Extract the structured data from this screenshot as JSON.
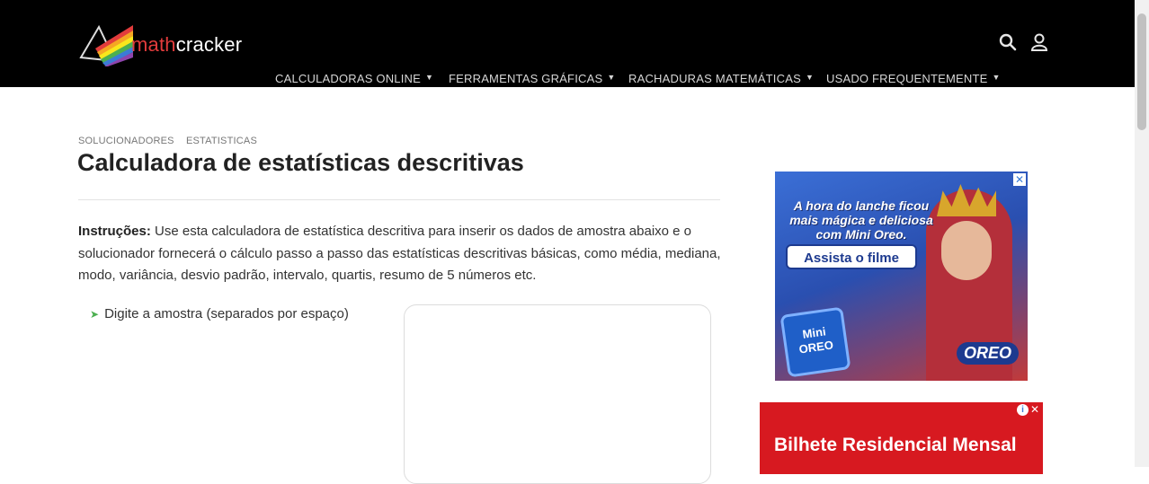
{
  "header": {
    "logo_text_a": "math",
    "logo_text_b": "cracker",
    "icons": [
      "search-icon",
      "user-icon"
    ],
    "nav": [
      {
        "label": "CALCULADORAS ONLINE"
      },
      {
        "label": "FERRAMENTAS GRÁFICAS"
      },
      {
        "label": "RACHADURAS MATEMÁTICAS"
      },
      {
        "label": "USADO FREQUENTEMENTE"
      }
    ]
  },
  "breadcrumb": [
    "SOLUCIONADORES",
    "ESTATISTICAS"
  ],
  "page_title": "Calculadora de estatísticas descritivas",
  "instructions": {
    "label": "Instruções:",
    "text": " Use esta calculadora de estatística descritiva para inserir os dados de amostra abaixo e o solucionador fornecerá o cálculo passo a passo das estatísticas descritivas básicas, como média, mediana, modo, variância, desvio padrão, intervalo, quartis, resumo de 5 números etc."
  },
  "sample": {
    "label": "Digite a amostra (separados por espaço)",
    "value": ""
  },
  "ads": {
    "ad1": {
      "headline": "A hora do lanche ficou mais mágica e deliciosa com Mini Oreo.",
      "cta": "Assista o filme",
      "pack_text": "Mini OREO",
      "brand": "OREO"
    },
    "ad2": {
      "text": "Bilhete Residencial Mensal"
    }
  },
  "colors": {
    "header_bg": "#000000",
    "accent_green": "#4caf50",
    "ad2_bg": "#d71920"
  }
}
